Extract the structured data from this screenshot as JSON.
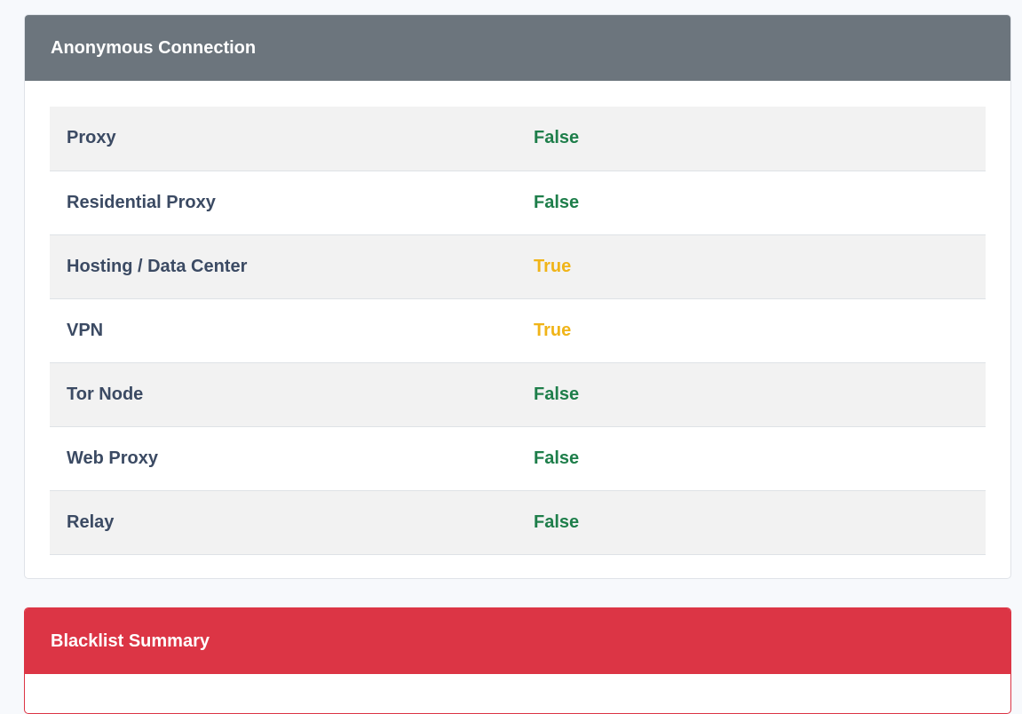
{
  "anonymous_connection": {
    "title": "Anonymous Connection",
    "rows": [
      {
        "label": "Proxy",
        "value": "False"
      },
      {
        "label": "Residential Proxy",
        "value": "False"
      },
      {
        "label": "Hosting / Data Center",
        "value": "True"
      },
      {
        "label": "VPN",
        "value": "True"
      },
      {
        "label": "Tor Node",
        "value": "False"
      },
      {
        "label": "Web Proxy",
        "value": "False"
      },
      {
        "label": "Relay",
        "value": "False"
      }
    ]
  },
  "blacklist_summary": {
    "title": "Blacklist Summary"
  },
  "colors": {
    "anon_header": "#6c757d",
    "blacklist_header": "#dc3545",
    "false_value": "#1e7e4a",
    "true_value": "#f0b418",
    "label_text": "#3b4a63"
  }
}
